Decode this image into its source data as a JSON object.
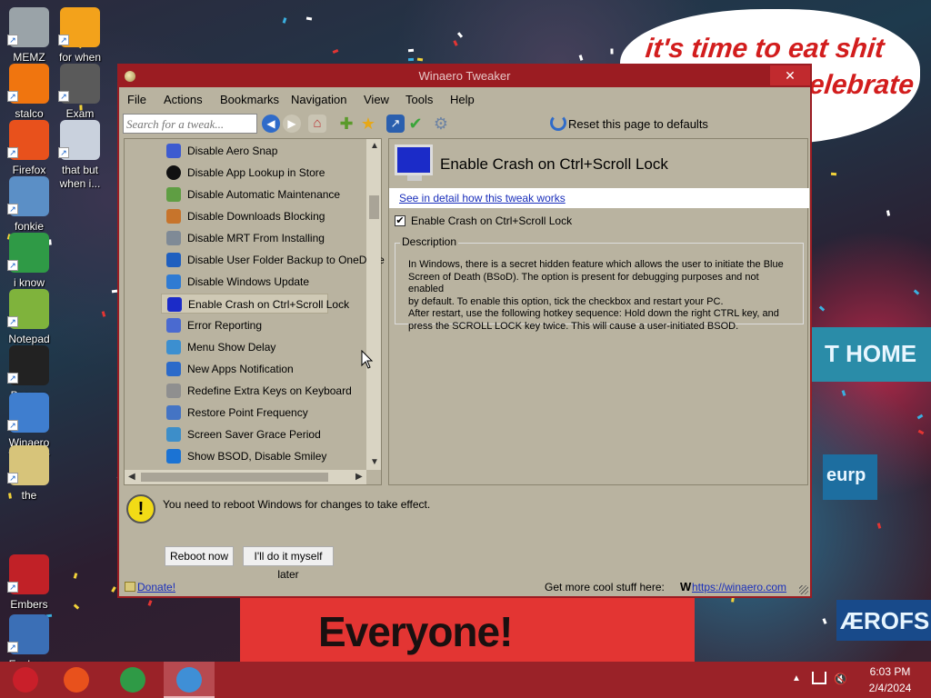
{
  "desktop": {
    "speech_bubble": {
      "line1": "it's time to eat shit",
      "line2": "elebrate"
    },
    "banner": {
      "line": "Everyone!"
    },
    "billboards": {
      "t_home": "T HOME",
      "europ": "eurp",
      "aerofs": "ÆROFS"
    },
    "icons": [
      {
        "label": "MEMZ",
        "icon": "recycle-bin-icon",
        "color": "#9aa3a8"
      },
      {
        "label": "for when",
        "icon": "photoshop-de-icon",
        "color": "#f3a21b"
      },
      {
        "label": "stalco",
        "icon": "ring-icon",
        "color": "#f0750f"
      },
      {
        "label": "Exam",
        "icon": "flash-player-icon",
        "color": "#5a5a5a"
      },
      {
        "label": "Firefox",
        "icon": "firefox-icon",
        "color": "#e8511c"
      },
      {
        "label": "that but when i...",
        "icon": "windows-stack-icon",
        "color": "#c9d1dd"
      },
      {
        "label": "fonkie",
        "icon": "settings-window-icon",
        "color": "#5b8fc6"
      },
      {
        "label": "i know",
        "icon": "chrome-icon",
        "color": "#2f9a46"
      },
      {
        "label": "Notepad",
        "icon": "notepad-icon",
        "color": "#7fb33c"
      },
      {
        "label": "Pecono",
        "icon": "dark-circle-icon",
        "color": "#222222"
      },
      {
        "label": "Winaero Tweaker",
        "icon": "winaero-icon",
        "color": "#3f7ecf"
      },
      {
        "label": "the",
        "icon": "document-icon",
        "color": "#d7c47a"
      },
      {
        "label": "Embers",
        "icon": "devcpp-icon",
        "color": "#c12127"
      },
      {
        "label": "Explorer",
        "icon": "explorer-window-icon",
        "color": "#3b6fb6"
      }
    ]
  },
  "window": {
    "title": "Winaero Tweaker",
    "close_label": "✕",
    "menu": [
      "File",
      "Actions",
      "Bookmarks",
      "Navigation",
      "View",
      "Tools",
      "Help"
    ],
    "toolbar": {
      "search_placeholder": "Search for a tweak...",
      "reset_label": "Reset this page to defaults"
    },
    "tree_items": [
      {
        "label": "Disable Aero Snap",
        "icon": "aero-snap-icon",
        "color": "#3d5bd0"
      },
      {
        "label": "Disable App Lookup in Store",
        "icon": "store-circle-icon",
        "color": "#111111"
      },
      {
        "label": "Disable Automatic Maintenance",
        "icon": "maintenance-icon",
        "color": "#5f9e43"
      },
      {
        "label": "Disable Downloads Blocking",
        "icon": "downloads-icon",
        "color": "#c7742b"
      },
      {
        "label": "Disable MRT From Installing",
        "icon": "mrt-icon",
        "color": "#7f8a96"
      },
      {
        "label": "Disable User Folder Backup to OneDrive",
        "icon": "onedrive-icon",
        "color": "#1f5fbf"
      },
      {
        "label": "Disable Windows Update",
        "icon": "windows-update-icon",
        "color": "#2f7bd3"
      },
      {
        "label": "Enable Crash on Ctrl+Scroll Lock",
        "icon": "bsod-monitor-icon",
        "color": "#1b2bc8",
        "selected": true
      },
      {
        "label": "Error Reporting",
        "icon": "error-reporting-icon",
        "color": "#4a6ad0"
      },
      {
        "label": "Menu Show Delay",
        "icon": "menu-delay-icon",
        "color": "#3c8fd0"
      },
      {
        "label": "New Apps Notification",
        "icon": "notification-icon",
        "color": "#2b6ac9"
      },
      {
        "label": "Redefine Extra Keys on Keyboard",
        "icon": "keyboard-icon",
        "color": "#8f8f8f"
      },
      {
        "label": "Restore Point Frequency",
        "icon": "restore-point-icon",
        "color": "#4474c4"
      },
      {
        "label": "Screen Saver Grace Period",
        "icon": "screensaver-icon",
        "color": "#3d8ec9"
      },
      {
        "label": "Show BSOD, Disable Smiley",
        "icon": "bsod-smiley-icon",
        "color": "#1b73d4"
      }
    ],
    "detail": {
      "title": "Enable Crash on Ctrl+Scroll Lock",
      "link": "See in detail how this tweak works",
      "checkbox_label": "Enable Crash on Ctrl+Scroll Lock",
      "checkbox_checked": true,
      "description_title": "Description",
      "description_lines": [
        "In Windows, there is a secret hidden feature which allows the user to initiate the Blue",
        "Screen of Death (BSoD). The option is present for debugging purposes and not enabled",
        "by default. To enable this option, tick the checkbox and restart your PC.",
        "After restart, use the following hotkey sequence: Hold down the right CTRL key, and",
        "press the SCROLL LOCK key twice. This will cause a user-initiated BSOD."
      ]
    },
    "footer": {
      "warning": "You need to reboot Windows for changes to take effect.",
      "reboot_button": "Reboot now",
      "later_button": "I'll do it myself later",
      "donate": "Donate!",
      "cool_stuff": "Get more cool stuff here:",
      "w_icon": "W",
      "winaero_link": "https://winaero.com"
    }
  },
  "taskbar": {
    "time": "6:03 PM",
    "date": "2/4/2024",
    "buttons": [
      {
        "icon": "start-ornament-icon",
        "color": "#c91f2a"
      },
      {
        "icon": "firefox-icon",
        "color": "#e8511c"
      },
      {
        "icon": "chrome-icon",
        "color": "#2f9a46"
      },
      {
        "icon": "winaero-tweaker-icon",
        "color": "#3f8fd6",
        "active": true
      }
    ]
  },
  "colors": {
    "title_bar": "#9b1c22",
    "window_bg": "#b9b3a0",
    "link": "#1a2fbb",
    "taskbar": "#9a2228"
  }
}
